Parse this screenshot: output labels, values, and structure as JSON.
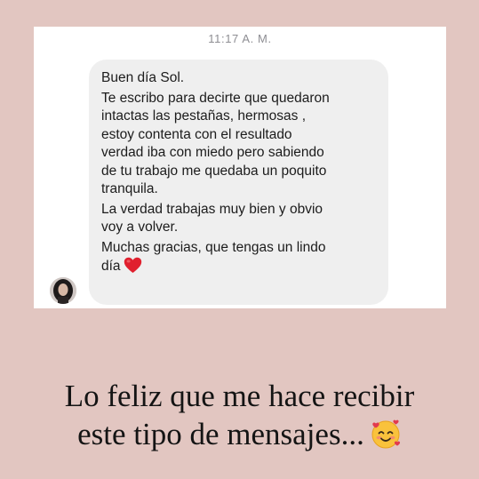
{
  "message_screenshot": {
    "timestamp": "11:17 A. M.",
    "avatar_icon": "profile-photo-avatar",
    "message_lines": [
      "Buen día Sol.",
      "Te escribo para decirte que quedaron",
      "intactas las pestañas,  hermosas ,",
      "estoy contenta con el resultado",
      "verdad iba con miedo   pero sabiendo",
      "de tu trabajo me quedaba un poquito",
      "tranquila.",
      "La verdad trabajas muy bien y obvio",
      "voy a volver.",
      "Muchas gracias,  que tengas un lindo",
      "día"
    ],
    "end_icon": "red-heart-icon",
    "colors": {
      "bubble": "#efefef",
      "heart": "#e0202e"
    }
  },
  "caption": {
    "line1": "Lo feliz que me hace recibir",
    "line2": "este tipo de mensajes...",
    "end_icon": "smiling-face-with-hearts-icon"
  },
  "colors": {
    "background": "#e2c6c1",
    "card": "#ffffff"
  }
}
